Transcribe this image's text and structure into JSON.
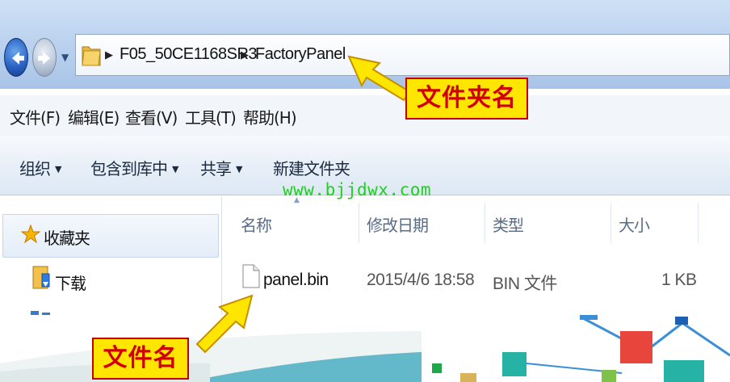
{
  "address_bar": {
    "crumbs": [
      "F05_50CE1168SR3",
      "FactoryPanel"
    ],
    "separator": "▶"
  },
  "menu": {
    "items": [
      "文件(F)",
      "编辑(E)",
      "查看(V)",
      "工具(T)",
      "帮助(H)"
    ]
  },
  "toolbar": {
    "organize": "组织",
    "include_in_library": "包含到库中",
    "share": "共享",
    "new_folder": "新建文件夹",
    "dropdown_glyph": "▼"
  },
  "nav_pane": {
    "favorites": "收藏夹",
    "downloads": "下载",
    "icons": [
      "star-icon",
      "download-folder-icon"
    ]
  },
  "file_list": {
    "columns": [
      "名称",
      "修改日期",
      "类型",
      "大小"
    ],
    "rows": [
      {
        "name": "panel.bin",
        "modified": "2015/4/6 18:58",
        "type": "BIN 文件",
        "size": "1 KB"
      }
    ]
  },
  "overlay": {
    "watermark": "www.bjjdwx.com",
    "folder_label": "文件夹名",
    "file_label": "文件名"
  },
  "colors": {
    "callout_fill": "#ffe600",
    "callout_text": "#d10000",
    "watermark": "#1fd01f",
    "title_bar": "#bcd3ef"
  }
}
